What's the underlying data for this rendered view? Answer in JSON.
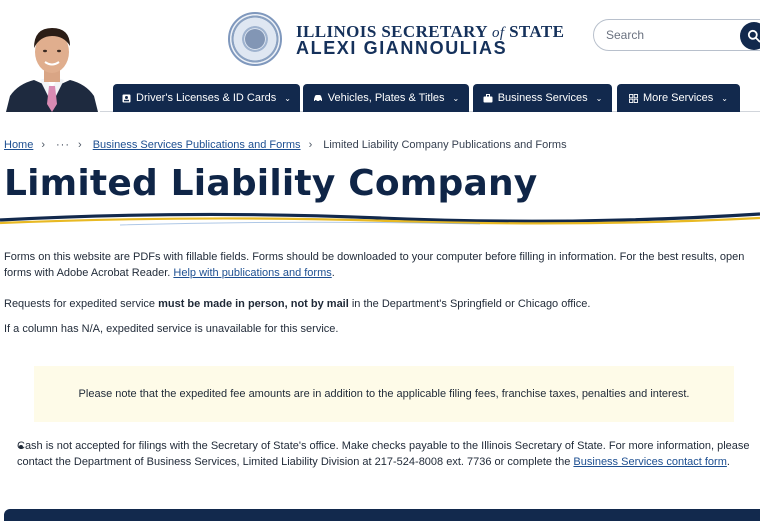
{
  "header": {
    "title_prefix": "ILLINOIS SECRETARY",
    "title_of": "of",
    "title_suffix": "STATE",
    "name": "ALEXI GIANNOULIAS",
    "search_placeholder": "Search"
  },
  "nav": {
    "items": [
      {
        "label": "Driver's Licenses & ID Cards",
        "icon": "id-card-icon"
      },
      {
        "label": "Vehicles, Plates & Titles",
        "icon": "car-icon"
      },
      {
        "label": "Business Services",
        "icon": "briefcase-icon"
      },
      {
        "label": "More Services",
        "icon": "grid-icon"
      }
    ]
  },
  "breadcrumb": {
    "home": "Home",
    "ellipsis": "···",
    "parent": "Business Services Publications and Forms",
    "current": "Limited Liability Company Publications and Forms"
  },
  "page": {
    "title": "Limited Liability Company",
    "intro_text": "Forms on this website are PDFs with fillable fields. Forms should be downloaded to your computer before filling in information. For the best results, open forms with Adobe Acrobat Reader.",
    "intro_link": "Help with publications and forms",
    "expedite_before": "Requests for expedited service ",
    "expedite_bold": "must be made in person, not by mail",
    "expedite_after": " in the Department's Springfield or Chicago office.",
    "na_note": "If a column has N/A, expedited service is unavailable for this service.",
    "notice": "Please note that the expedited fee amounts are in addition to the applicable filing fees, franchise taxes, penalties and interest.",
    "bullet_text": "Cash is not accepted for filings with the Secretary of State's office. Make checks payable to the Illinois Secretary of State. For more information, please contact the Department of Business Services, Limited Liability Division at 217-524-8008 ext. 7736 or complete the",
    "bullet_link": "Business Services contact form",
    "bullet_end": "."
  },
  "colors": {
    "navy": "#12294d",
    "link": "#1d4f91",
    "gold": "#e8b923",
    "notice_bg": "#fefbe8"
  }
}
